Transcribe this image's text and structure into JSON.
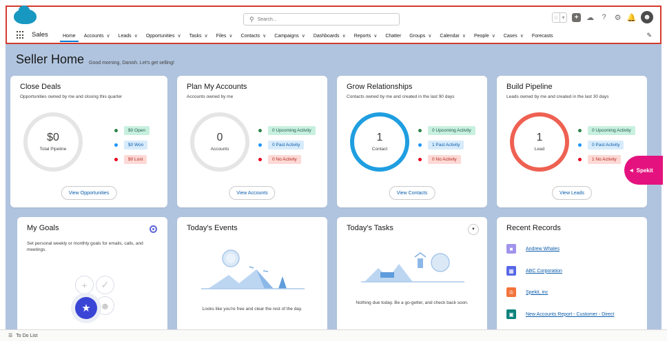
{
  "app": {
    "name": "Sales"
  },
  "search": {
    "placeholder": "Search..."
  },
  "header": {
    "help": "?"
  },
  "nav": {
    "tabs": [
      {
        "label": "Home",
        "chevron": false,
        "active": true
      },
      {
        "label": "Accounts",
        "chevron": true
      },
      {
        "label": "Leads",
        "chevron": true
      },
      {
        "label": "Opportunities",
        "chevron": true
      },
      {
        "label": "Tasks",
        "chevron": true
      },
      {
        "label": "Files",
        "chevron": true
      },
      {
        "label": "Contacts",
        "chevron": true
      },
      {
        "label": "Campaigns",
        "chevron": true
      },
      {
        "label": "Dashboards",
        "chevron": true
      },
      {
        "label": "Reports",
        "chevron": true
      },
      {
        "label": "Chatter",
        "chevron": false
      },
      {
        "label": "Groups",
        "chevron": true
      },
      {
        "label": "Calendar",
        "chevron": true
      },
      {
        "label": "People",
        "chevron": true
      },
      {
        "label": "Cases",
        "chevron": true
      },
      {
        "label": "Forecasts",
        "chevron": false
      }
    ]
  },
  "page": {
    "title": "Seller Home",
    "greeting": "Good morning, Danish. Let's get selling!"
  },
  "cards": {
    "close_deals": {
      "title": "Close Deals",
      "subtitle": "Opportunities owned by me and closing this quarter",
      "value": "$0",
      "label": "Total Pipeline",
      "legend": [
        "$0 Open",
        "$0 Won",
        "$0 Lost"
      ],
      "button": "View Opportunities"
    },
    "plan_accounts": {
      "title": "Plan My Accounts",
      "subtitle": "Accounts owned by me",
      "value": "0",
      "label": "Accounts",
      "legend": [
        "0 Upcoming Activity",
        "0 Past Activity",
        "0 No Activity"
      ],
      "button": "View Accounts"
    },
    "grow_relationships": {
      "title": "Grow Relationships",
      "subtitle": "Contacts owned by me and created in the last 90 days",
      "value": "1",
      "label": "Contact",
      "legend": [
        "0 Upcoming Activity",
        "1 Past Activity",
        "0 No Activity"
      ],
      "button": "View Contacts"
    },
    "build_pipeline": {
      "title": "Build Pipeline",
      "subtitle": "Leads owned by me and created in the last 30 days",
      "value": "1",
      "label": "Lead",
      "legend": [
        "0 Upcoming Activity",
        "0 Past Activity",
        "1 No Activity"
      ],
      "button": "View Leads"
    },
    "goals": {
      "title": "My Goals",
      "subtitle": "Set personal weekly or monthly goals for emails, calls, and meetings.",
      "plus": "+",
      "check": "✓",
      "star": "★"
    },
    "events": {
      "title": "Today's Events",
      "message": "Looks like you're free and clear the rest of the day."
    },
    "tasks": {
      "title": "Today's Tasks",
      "message": "Nothing due today. Be a go-getter, and check back soon."
    },
    "recent": {
      "title": "Recent Records",
      "items": [
        {
          "label": "Andrew Whales",
          "icon": "contact-icon",
          "color": "#a094ed"
        },
        {
          "label": "ABC Corporation",
          "icon": "account-icon",
          "color": "#5867e8"
        },
        {
          "label": "Spekit, inc",
          "icon": "lead-icon",
          "color": "#f2743b"
        },
        {
          "label": "New Accounts Report - Customer - Direct",
          "icon": "report-icon",
          "color": "#0b827c"
        }
      ]
    }
  },
  "spekit": {
    "label": "Spekit"
  },
  "footer": {
    "todo": "To Do List"
  },
  "colors": {
    "brand": "#1798c1",
    "accent": "#0176d3",
    "header_border": "#d33a2c",
    "background": "#b0c4df",
    "ring_gray": "#e5e5e5",
    "ring_blue": "#1f9ee0",
    "ring_red": "#ee6152",
    "dot_green": "#2e844a",
    "dot_blue": "#1b96ff",
    "dot_red": "#ea001e",
    "spekit": "#e4127f",
    "goal_star": "#3a45d6"
  }
}
